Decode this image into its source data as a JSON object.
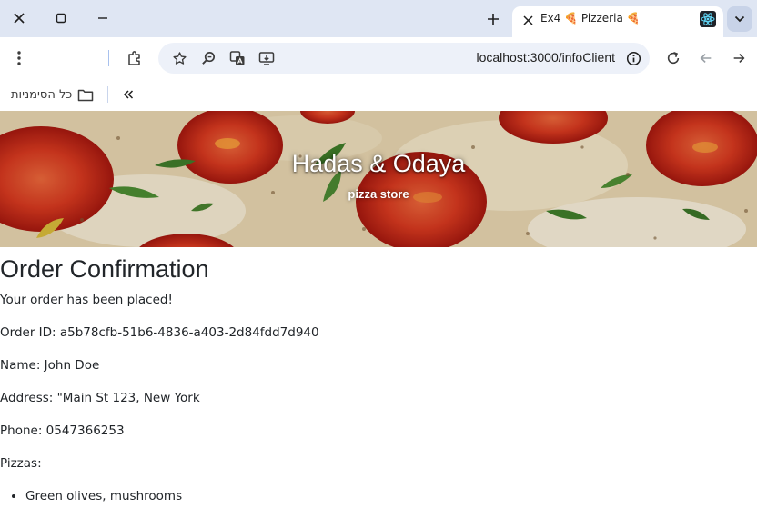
{
  "browser": {
    "tab_title": "Ex4 🍕 Pizzeria 🍕",
    "url": "localhost:3000/infoClient",
    "bookmarks_label": "כל הסימניות"
  },
  "hero": {
    "title": "Hadas & Odaya",
    "subtitle": "pizza store"
  },
  "order": {
    "heading": "Order Confirmation",
    "message": "Your order has been placed!",
    "order_id": "Order ID: a5b78cfb-51b6-4836-a403-2d84fdd7d940",
    "name": "Name: John Doe",
    "address": "Address: \"Main St 123, New York",
    "phone": "Phone: 0547366253",
    "pizzas_label": "Pizzas:",
    "pizzas": [
      "Green olives, mushrooms"
    ]
  },
  "icons": {
    "close": "close-icon",
    "maximize": "maximize-icon",
    "minimize": "minimize-icon",
    "new_tab": "plus-icon",
    "tab_favicon": "react-icon",
    "tab_search": "chevron-down-icon",
    "menu": "kebab-menu-icon",
    "extensions": "puzzle-icon",
    "bookmark_star": "star-icon",
    "zoom": "zoom-icon",
    "translate": "translate-icon",
    "install": "install-app-icon",
    "site_info": "info-icon",
    "reload": "reload-icon",
    "back": "arrow-left-icon",
    "forward": "arrow-right-icon",
    "folder": "folder-icon",
    "chevrons": "double-chevron-icon"
  }
}
